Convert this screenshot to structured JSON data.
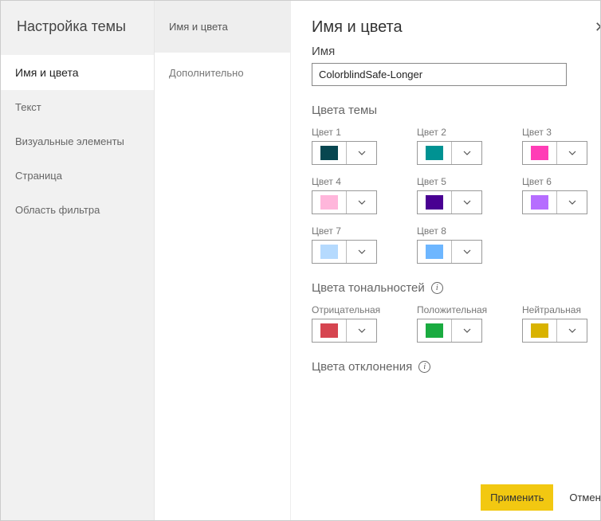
{
  "sidebar1": {
    "header": "Настройка темы",
    "items": [
      {
        "label": "Имя и цвета",
        "active": true
      },
      {
        "label": "Текст",
        "active": false
      },
      {
        "label": "Визуальные элементы",
        "active": false
      },
      {
        "label": "Страница",
        "active": false
      },
      {
        "label": "Область фильтра",
        "active": false
      }
    ]
  },
  "sidebar2": {
    "items": [
      {
        "label": "Имя и цвета",
        "active": true
      },
      {
        "label": "Дополнительно",
        "active": false
      }
    ]
  },
  "main": {
    "title": "Имя и цвета",
    "name_label": "Имя",
    "name_value": "ColorblindSafe-Longer",
    "theme_colors_title": "Цвета темы",
    "theme_colors": [
      {
        "label": "Цвет 1",
        "hex": "#074650"
      },
      {
        "label": "Цвет 2",
        "hex": "#009292"
      },
      {
        "label": "Цвет 3",
        "hex": "#ff3db6"
      },
      {
        "label": "Цвет 4",
        "hex": "#ffb6db"
      },
      {
        "label": "Цвет 5",
        "hex": "#490092"
      },
      {
        "label": "Цвет 6",
        "hex": "#b66dff"
      },
      {
        "label": "Цвет 7",
        "hex": "#b5dafe"
      },
      {
        "label": "Цвет 8",
        "hex": "#6db6ff"
      }
    ],
    "sentiment_title": "Цвета тональностей",
    "sentiment_colors": [
      {
        "label": "Отрицательная",
        "hex": "#d64550"
      },
      {
        "label": "Положительная",
        "hex": "#1aab40"
      },
      {
        "label": "Нейтральная",
        "hex": "#d9b300"
      }
    ],
    "divergence_title": "Цвета отклонения"
  },
  "footer": {
    "apply": "Применить",
    "cancel": "Отмена"
  }
}
